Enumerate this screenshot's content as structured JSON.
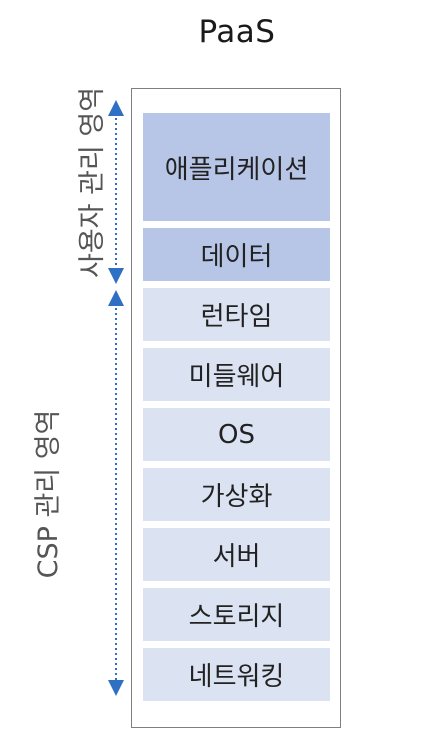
{
  "title": "PaaS",
  "layers": [
    {
      "label": "애플리케이션",
      "owner": "user"
    },
    {
      "label": "데이터",
      "owner": "user"
    },
    {
      "label": "런타임",
      "owner": "csp"
    },
    {
      "label": "미들웨어",
      "owner": "csp"
    },
    {
      "label": "OS",
      "owner": "csp"
    },
    {
      "label": "가상화",
      "owner": "csp"
    },
    {
      "label": "서버",
      "owner": "csp"
    },
    {
      "label": "스토리지",
      "owner": "csp"
    },
    {
      "label": "네트워킹",
      "owner": "csp"
    }
  ],
  "side_labels": {
    "user": "사용자 관리 영역",
    "csp": "CSP 관리 영역"
  },
  "colors": {
    "user_layer": "#b7c6e6",
    "csp_layer": "#dbe2f1",
    "arrow": "#2f6fc4"
  }
}
